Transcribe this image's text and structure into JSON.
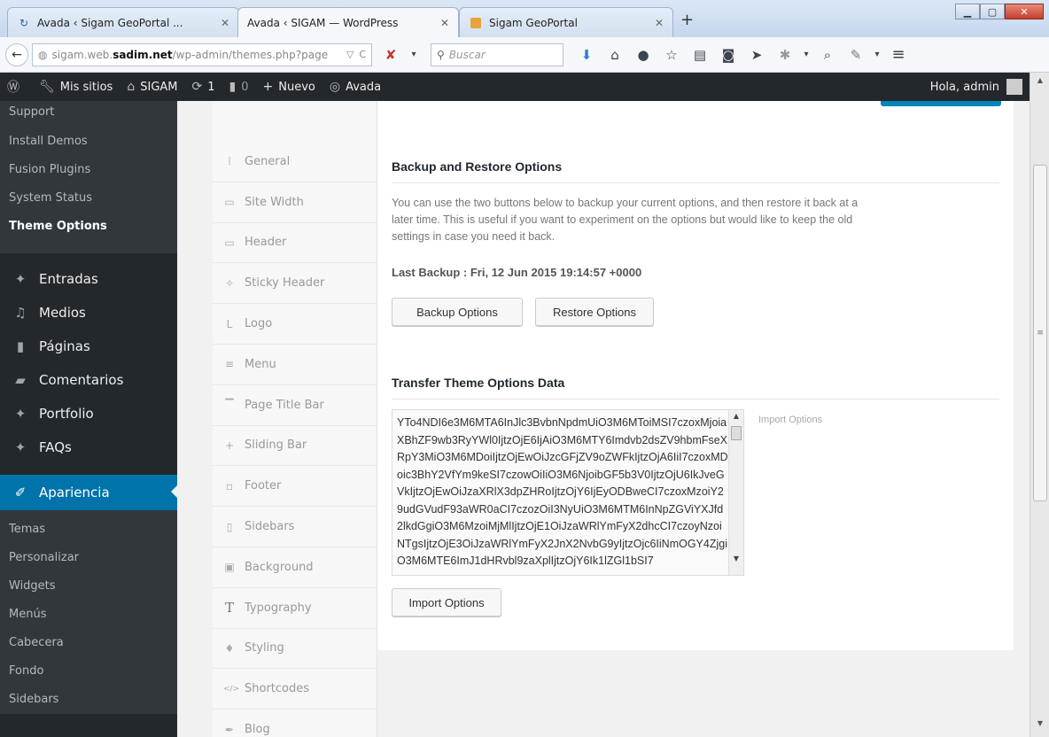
{
  "browser": {
    "tabs": [
      {
        "title": "Avada ‹ Sigam GeoPortal ...",
        "icon": "refresh-icon"
      },
      {
        "title": "Avada ‹ SIGAM — WordPress",
        "icon": "none"
      },
      {
        "title": "Sigam GeoPortal",
        "icon": "page-icon"
      }
    ],
    "url": {
      "prefix": "sigam.web.",
      "host": "sadim.net",
      "path": "/wp-admin/themes.php?page"
    },
    "search_placeholder": "Buscar"
  },
  "adminbar": {
    "mis_sitios": "Mis sitios",
    "site": "SIGAM",
    "updates": "1",
    "comments": "0",
    "nuevo": "Nuevo",
    "avada": "Avada",
    "greeting": "Hola, admin"
  },
  "sidebar": {
    "top_sub": [
      "Support",
      "Install Demos",
      "Fusion Plugins",
      "System Status",
      "Theme Options"
    ],
    "menu": [
      {
        "label": "Entradas",
        "icon": "pin-icon"
      },
      {
        "label": "Medios",
        "icon": "media-icon"
      },
      {
        "label": "Páginas",
        "icon": "pages-icon"
      },
      {
        "label": "Comentarios",
        "icon": "comment-icon"
      },
      {
        "label": "Portfolio",
        "icon": "pin-icon"
      },
      {
        "label": "FAQs",
        "icon": "pin-icon"
      },
      {
        "label": "Apariencia",
        "icon": "brush-icon"
      }
    ],
    "apariencia_sub": [
      "Temas",
      "Personalizar",
      "Widgets",
      "Menús",
      "Cabecera",
      "Fondo",
      "Sidebars"
    ]
  },
  "options_nav": [
    {
      "label": "General",
      "icon": "sliders-icon"
    },
    {
      "label": "Site Width",
      "icon": "width-icon"
    },
    {
      "label": "Header",
      "icon": "header-icon"
    },
    {
      "label": "Sticky Header",
      "icon": "pin-icon"
    },
    {
      "label": "Logo",
      "icon": "logo-icon"
    },
    {
      "label": "Menu",
      "icon": "menu-icon"
    },
    {
      "label": "Page Title Bar",
      "icon": "titlebar-icon"
    },
    {
      "label": "Sliding Bar",
      "icon": "plus-icon"
    },
    {
      "label": "Footer",
      "icon": "footer-icon"
    },
    {
      "label": "Sidebars",
      "icon": "sidebar-icon"
    },
    {
      "label": "Background",
      "icon": "image-icon"
    },
    {
      "label": "Typography",
      "icon": "type-icon"
    },
    {
      "label": "Styling",
      "icon": "drop-icon"
    },
    {
      "label": "Shortcodes",
      "icon": "code-icon"
    },
    {
      "label": "Blog",
      "icon": "pen-icon"
    }
  ],
  "backup": {
    "heading": "Backup and Restore Options",
    "description": "You can use the two buttons below to backup your current options, and then restore it back at a later time. This is useful if you want to experiment on the options but would like to keep the old settings in case you need it back.",
    "last_backup": "Last Backup : Fri, 12 Jun 2015 19:14:57 +0000",
    "backup_btn": "Backup Options",
    "restore_btn": "Restore Options"
  },
  "transfer": {
    "heading": "Transfer Theme Options Data",
    "data": "YTo4NDI6e3M6MTA6InJlc3BvbnNpdmUiO3M6MToiMSI7czoxMjoiaXBhZF9wb3RyYWl0IjtzOjE6IjAiO3M6MTY6Imdvb2dsZV9hbmFseXRpY3MiO3M6MDoiIjtzOjEwOiJzcGFjZV9oZWFkIjtzOjA6IiI7czoxMDoic3BhY2VfYm9keSI7czowOiIiO3M6NjoibGF5b3V0IjtzOjU6IkJveGVkIjtzOjEwOiJzaXRlX3dpZHRoIjtzOjY6IjEyODBweCI7czoxMzoiY29udGVudF93aWR0aCI7czozOiI3NyUiO3M6MTM6InNpZGViYXJfd2lkdGgiO3M6MzoiMjMlIjtzOjE1OiJzaWRlYmFyX2dhcCI7czoyNzoiNTgsIjtzOjE3OiJzaWRlYmFyX2JnX2NvbG9yIjtzOjc6IiNmOGY4ZjgiO3M6MTE6ImJ1dHRvbl9zaXplIjtzOjY6Ik1lZGl1bSI7",
    "import_label": "Import Options",
    "import_btn": "Import Options"
  },
  "colors": {
    "wp_dark": "#23282d",
    "wp_blue": "#0073aa",
    "bg": "#f1f1f1"
  }
}
